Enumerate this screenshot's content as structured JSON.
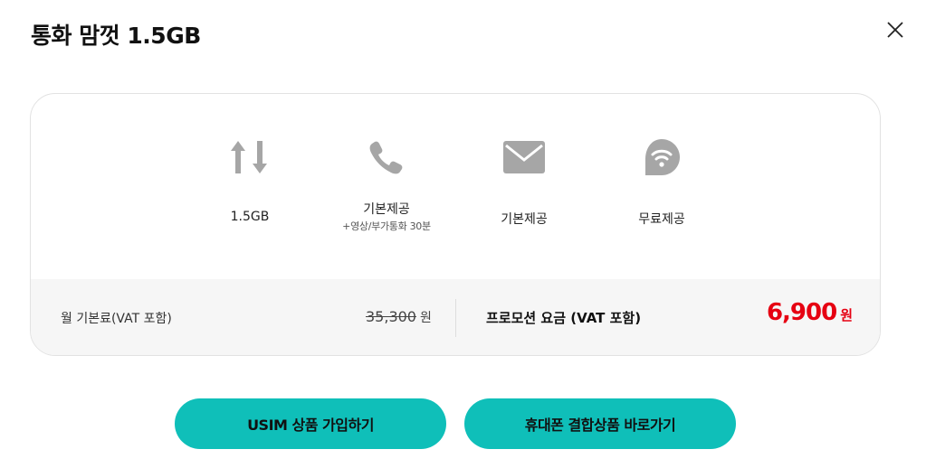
{
  "header": {
    "title": "통화 맘껏 1.5GB",
    "close_icon": "close-icon"
  },
  "features": [
    {
      "icon": "data-transfer-icon",
      "label": "1.5GB",
      "sub": ""
    },
    {
      "icon": "phone-icon",
      "label": "기본제공",
      "sub": "+영상/부가통화 30분"
    },
    {
      "icon": "mail-icon",
      "label": "기본제공",
      "sub": ""
    },
    {
      "icon": "wifi-icon",
      "label": "무료제공",
      "sub": ""
    }
  ],
  "pricing": {
    "monthly_label": "월 기본료(VAT 포함)",
    "original_price": "35,300",
    "original_unit": "원",
    "promo_label": "프로모션 요금 (VAT 포함)",
    "promo_price": "6,900",
    "promo_unit": "원"
  },
  "buttons": {
    "usim_label": "USIM 상품 가입하기",
    "phone_bundle_label": "휴대폰 결합상품 바로가기"
  },
  "colors": {
    "accent": "#0fbfb9",
    "price_red": "#e60012",
    "icon_gray": "#a6a6a6",
    "pricebar_bg": "#f6f6f6"
  }
}
